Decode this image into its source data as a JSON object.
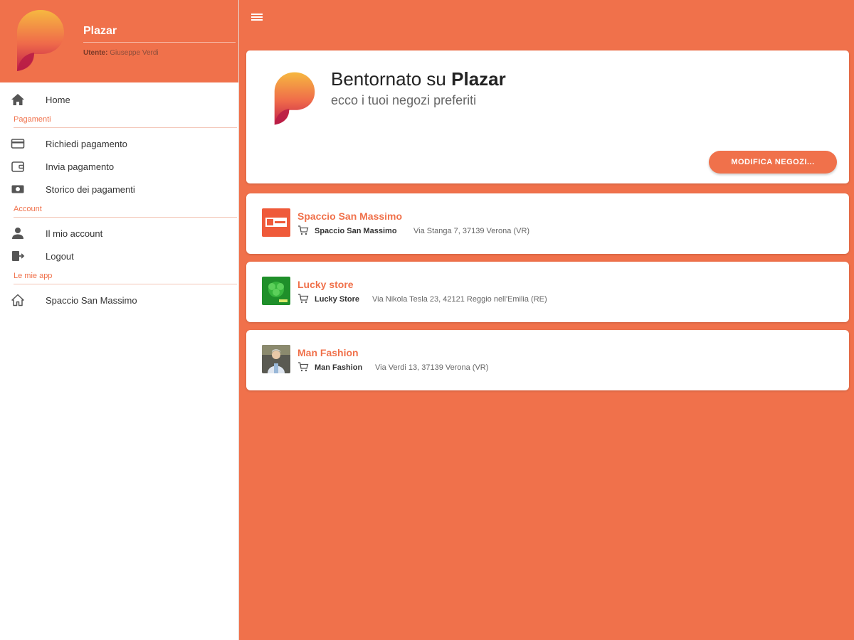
{
  "app": {
    "name": "Plazar"
  },
  "colors": {
    "accent": "#f0714b",
    "logo_top": "#f6b840",
    "logo_bottom": "#c2204a"
  },
  "sidebar": {
    "title": "Plazar",
    "user_label": "Utente:",
    "user_name": "Giuseppe Verdi",
    "home": {
      "label": "Home",
      "icon": "home-icon"
    },
    "sections": [
      {
        "label": "Pagamenti",
        "items": [
          {
            "label": "Richiedi pagamento",
            "icon": "credit-card-icon"
          },
          {
            "label": "Invia pagamento",
            "icon": "wallet-icon"
          },
          {
            "label": "Storico dei pagamenti",
            "icon": "money-icon"
          }
        ]
      },
      {
        "label": "Account",
        "items": [
          {
            "label": "Il mio account",
            "icon": "user-icon"
          },
          {
            "label": "Logout",
            "icon": "logout-icon"
          }
        ]
      },
      {
        "label": "Le mie app",
        "items": [
          {
            "label": "Spaccio San Massimo",
            "icon": "home-outline-icon"
          }
        ]
      }
    ]
  },
  "topbar": {
    "menu_icon": "hamburger-icon"
  },
  "welcome": {
    "title_prefix": "Bentornato su",
    "title_brand": "Plazar",
    "subtitle": "ecco i tuoi negozi preferiti",
    "button_label": "MODIFICA NEGOZI..."
  },
  "stores": [
    {
      "name": "Spaccio San Massimo",
      "shop": "Spaccio San Massimo",
      "address": "Via Stanga 7, 37139 Verona (VR)"
    },
    {
      "name": "Lucky store",
      "shop": "Lucky Store",
      "address": "Via Nikola Tesla 23, 42121 Reggio nell'Emilia (RE)"
    },
    {
      "name": "Man Fashion",
      "shop": "Man Fashion",
      "address": "Via Verdi 13, 37139 Verona (VR)"
    }
  ]
}
